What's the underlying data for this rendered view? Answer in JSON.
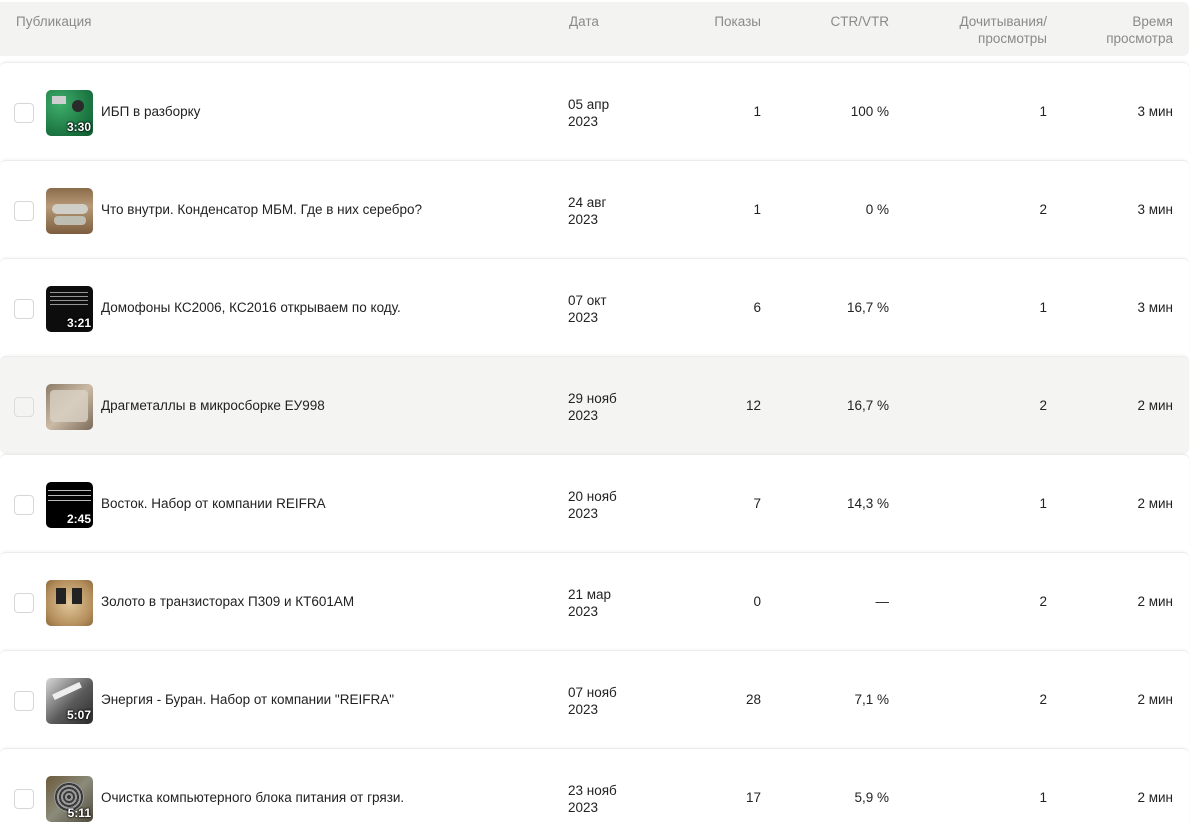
{
  "header": {
    "publication": "Публикация",
    "date": "Дата",
    "views": "Показы",
    "ctr": "CTR/VTR",
    "reads_line1": "Дочитывания/",
    "reads_line2": "просмотры",
    "time_line1": "Время",
    "time_line2": "просмотра"
  },
  "rows": [
    {
      "title": "ИБП в разборку",
      "duration": "3:30",
      "thumb_icon": "circuit-board-thumbnail",
      "date_line1": "05 апр",
      "date_line2": "2023",
      "views": "1",
      "ctr": "100 %",
      "reads": "1",
      "time": "3 мин"
    },
    {
      "title": "Что внутри. Конденсатор МБМ. Где в них серебро?",
      "duration": "",
      "thumb_icon": "capacitor-thumbnail",
      "date_line1": "24 авг",
      "date_line2": "2023",
      "views": "1",
      "ctr": "0 %",
      "reads": "2",
      "time": "3 мин"
    },
    {
      "title": "Домофоны КС2006, КС2016 открываем по коду.",
      "duration": "3:21",
      "thumb_icon": "intercom-thumbnail",
      "date_line1": "07 окт",
      "date_line2": "2023",
      "views": "6",
      "ctr": "16,7 %",
      "reads": "1",
      "time": "3 мин"
    },
    {
      "title": "Драгметаллы в микросборке ЕУ998",
      "duration": "",
      "thumb_icon": "microassembly-thumbnail",
      "date_line1": "29 нояб",
      "date_line2": "2023",
      "views": "12",
      "ctr": "16,7 %",
      "reads": "2",
      "time": "2 мин"
    },
    {
      "title": "Восток. Набор от компании REIFRA",
      "duration": "2:45",
      "thumb_icon": "text-slide-thumbnail",
      "date_line1": "20 нояб",
      "date_line2": "2023",
      "views": "7",
      "ctr": "14,3 %",
      "reads": "1",
      "time": "2 мин"
    },
    {
      "title": "Золото в транзисторах П309 и КТ601АМ",
      "duration": "",
      "thumb_icon": "transistors-thumbnail",
      "date_line1": "21 мар",
      "date_line2": "2023",
      "views": "0",
      "ctr": "—",
      "reads": "2",
      "time": "2 мин"
    },
    {
      "title": "Энергия - Буран. Набор от компании \"REIFRA\"",
      "duration": "5:07",
      "thumb_icon": "model-kit-thumbnail",
      "date_line1": "07 нояб",
      "date_line2": "2023",
      "views": "28",
      "ctr": "7,1 %",
      "reads": "2",
      "time": "2 мин"
    },
    {
      "title": "Очистка компьютерного блока питания от грязи.",
      "duration": "5:11",
      "thumb_icon": "power-supply-fan-thumbnail",
      "date_line1": "23 нояб",
      "date_line2": "2023",
      "views": "17",
      "ctr": "5,9 %",
      "reads": "1",
      "time": "2 мин"
    }
  ],
  "colors": {
    "header_bg": "#f3f3f1",
    "header_text": "#8a8a8a",
    "row_hover_bg": "#f4f4f2",
    "text": "#222222"
  },
  "hovered_row_index": 3
}
